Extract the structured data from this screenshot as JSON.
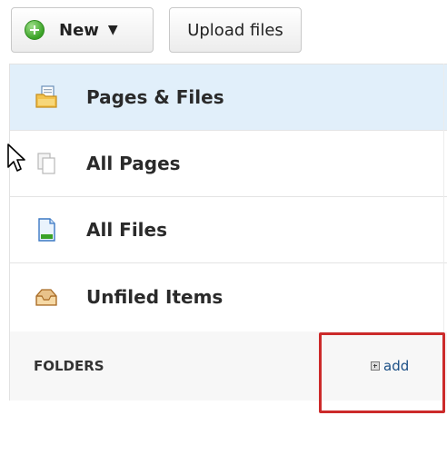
{
  "toolbar": {
    "new_label": "New",
    "new_caret": "▼",
    "upload_label": "Upload files"
  },
  "nav": {
    "items": [
      {
        "label": "Pages & Files",
        "icon": "pages-files-icon",
        "selected": true
      },
      {
        "label": "All Pages",
        "icon": "all-pages-icon",
        "selected": false
      },
      {
        "label": "All Files",
        "icon": "file-icon",
        "selected": false
      },
      {
        "label": "Unfiled Items",
        "icon": "inbox-tray-icon",
        "selected": false
      }
    ]
  },
  "folders": {
    "header": "FOLDERS",
    "add_label": "add"
  },
  "colors": {
    "selected_bg": "#e1effa",
    "link": "#1b4f86",
    "highlight": "#cc2a2a"
  }
}
